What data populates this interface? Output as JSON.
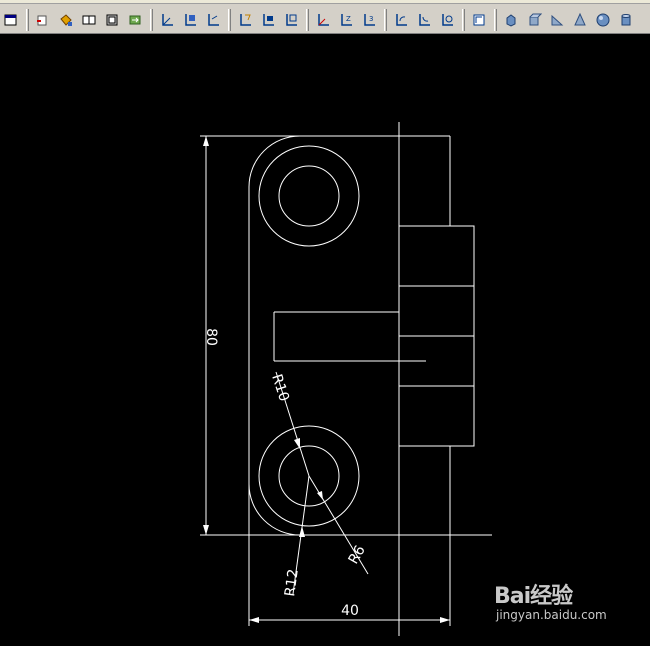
{
  "toolbar": {
    "icons": [
      "window-icon",
      "insert-block-icon",
      "paint-bucket-icon",
      "copy-object-icon",
      "box-frame-icon",
      "refresh-view-icon",
      "ucs-icon",
      "ucs-world-icon",
      "ucs-previous-icon",
      "ucs-face-icon",
      "ucs-object-icon",
      "ucs-view-icon",
      "ucs-origin-icon",
      "ucs-zaxis-icon",
      "ucs-3point-icon",
      "ucs-x-rotate-icon",
      "ucs-y-rotate-icon",
      "ucs-z-rotate-icon",
      "ucs-apply-icon",
      "solid-box-icon",
      "solid-cube-icon",
      "solid-wedge-icon",
      "solid-cone-icon",
      "solid-sphere-icon",
      "solid-cylinder-icon"
    ]
  },
  "drawing": {
    "dim_height": "80",
    "dim_width": "40",
    "dim_r10": "R10",
    "dim_r12": "R12",
    "dim_r6": "R6",
    "line_color": "#ffffff"
  },
  "watermark": {
    "brand": "Bai经验",
    "url": "jingyan.baidu.com"
  }
}
